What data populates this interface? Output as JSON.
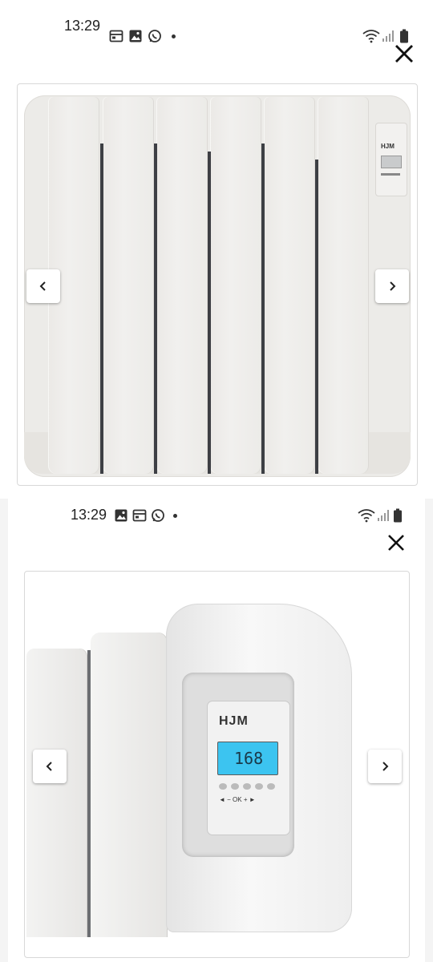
{
  "screen1": {
    "status": {
      "time": "13:29"
    },
    "gallery": {
      "brand": "HJM"
    }
  },
  "screen2": {
    "status": {
      "time": "13:29"
    },
    "gallery": {
      "brand": "HJM",
      "lcd_value": "168",
      "buttons_row": "◄ − OK + ►"
    }
  },
  "icons": {
    "close": "close-icon",
    "prev": "chevron-left-icon",
    "next": "chevron-right-icon",
    "calendar": "calendar-icon",
    "image": "image-icon",
    "whatsapp": "whatsapp-icon",
    "wifi": "wifi-icon",
    "signal": "signal-icon",
    "battery": "battery-icon"
  },
  "colors": {
    "lcd": "#3cc4f0",
    "radiator": "#eceae7",
    "divider": "#3d3f44"
  }
}
